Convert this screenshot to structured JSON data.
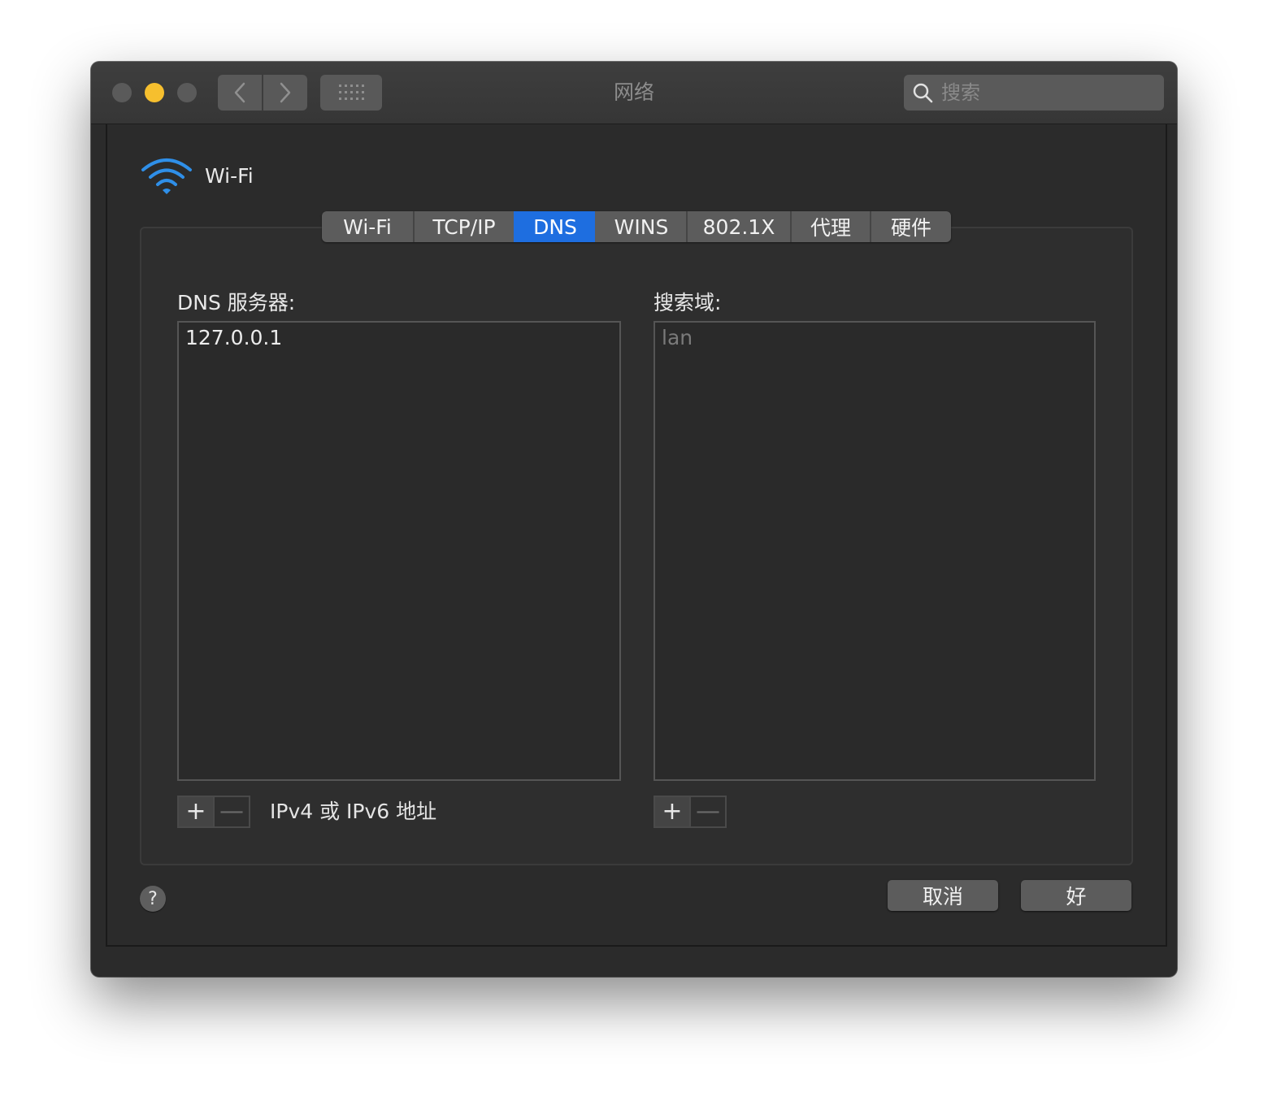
{
  "window": {
    "title": "网络"
  },
  "search": {
    "placeholder": "搜索"
  },
  "service": {
    "name": "Wi-Fi"
  },
  "tabs": [
    {
      "label": "Wi-Fi",
      "active": false
    },
    {
      "label": "TCP/IP",
      "active": false
    },
    {
      "label": "DNS",
      "active": true
    },
    {
      "label": "WINS",
      "active": false
    },
    {
      "label": "802.1X",
      "active": false
    },
    {
      "label": "代理",
      "active": false
    },
    {
      "label": "硬件",
      "active": false
    }
  ],
  "dns_servers": {
    "label": "DNS 服务器:",
    "entries": [
      "127.0.0.1"
    ],
    "hint": "IPv4 或 IPv6 地址"
  },
  "search_domains": {
    "label": "搜索域:",
    "entries": [
      "lan"
    ]
  },
  "controls": {
    "plus": "+",
    "minus": "—"
  },
  "footer": {
    "help": "?",
    "cancel": "取消",
    "ok": "好"
  },
  "colors": {
    "accent": "#1e6ee0",
    "minimize": "#f6bf2e",
    "wifi": "#2f8fe8"
  }
}
